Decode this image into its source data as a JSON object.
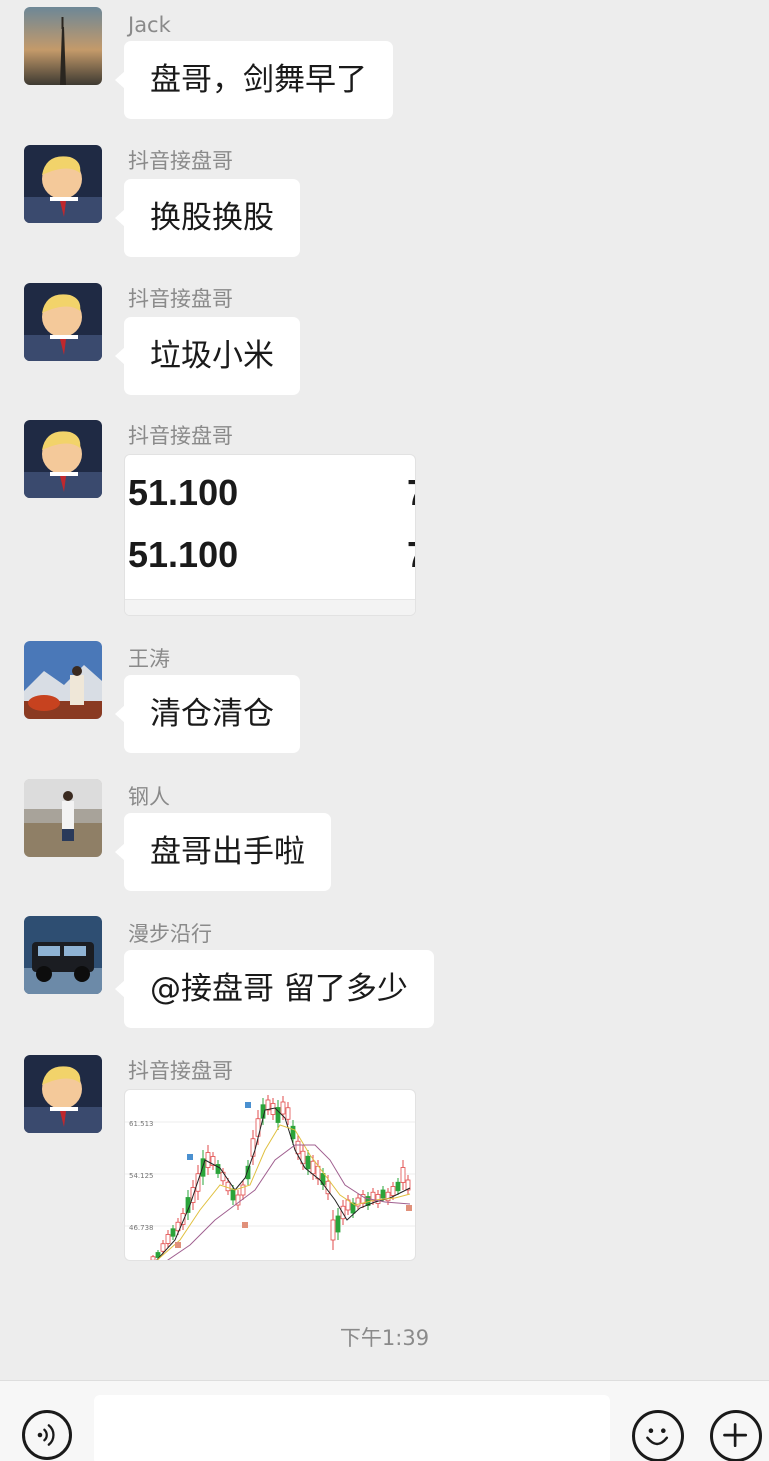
{
  "messages": [
    {
      "sender": "Jack",
      "text": "盘哥，剑舞早了",
      "avatar": "sunset-tower-avatar"
    },
    {
      "sender": "抖音接盘哥",
      "text": "换股换股",
      "avatar": "cartoon-avatar"
    },
    {
      "sender": "抖音接盘哥",
      "text": "垃圾小米",
      "avatar": "cartoon-avatar"
    },
    {
      "sender": "抖音接盘哥",
      "image": {
        "rows": [
          "51.100",
          "51.100"
        ],
        "cut_char": "7"
      },
      "avatar": "cartoon-avatar"
    },
    {
      "sender": "王涛",
      "text": "清仓清仓",
      "avatar": "mountain-person-avatar"
    },
    {
      "sender": "钢人",
      "text": "盘哥出手啦",
      "avatar": "beach-person-avatar"
    },
    {
      "sender": "漫步沿行",
      "text": "@接盘哥  留了多少",
      "avatar": "suv-avatar"
    },
    {
      "sender": "抖音接盘哥",
      "chart_image": {
        "y_ticks": [
          "61.513",
          "54.125",
          "46.738"
        ]
      },
      "avatar": "cartoon-avatar"
    }
  ],
  "timestamp": "下午1:39",
  "input_bar": {
    "voice_icon": "voice-icon",
    "emoji_icon": "emoji-icon",
    "plus_icon": "plus-icon"
  },
  "colors": {
    "background": "#ededed",
    "bubble": "#ffffff",
    "sender": "#8a8a8a",
    "candle_up": "#e24b4b",
    "candle_down": "#2aa43a"
  }
}
